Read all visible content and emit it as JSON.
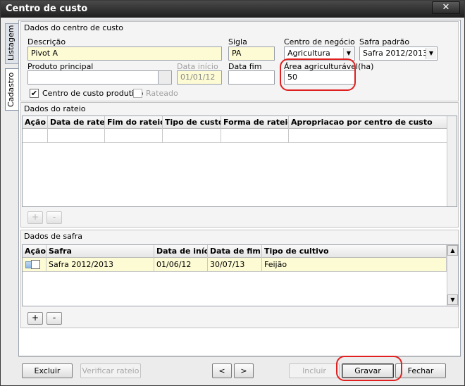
{
  "window": {
    "title": "Centro de custo",
    "close_symbol": "✕"
  },
  "tabs": [
    {
      "label": "Listagem",
      "active": false
    },
    {
      "label": "Cadastro",
      "active": true
    }
  ],
  "dados_centro": {
    "section_title": "Dados do centro de custo",
    "descricao_label": "Descrição",
    "descricao_value": "Pivot A",
    "sigla_label": "Sigla",
    "sigla_value": "PA",
    "centro_negocio_label": "Centro de negócio",
    "centro_negocio_value": "Agricultura",
    "safra_padrao_label": "Safra padrão",
    "safra_padrao_value": "Safra 2012/2013",
    "produto_label": "Produto principal",
    "produto_value": "",
    "data_inicio_label": "Data início",
    "data_inicio_value": "01/01/12",
    "data_fim_label": "Data fim",
    "data_fim_value": "",
    "area_label": "Área agriculturável(ha)",
    "area_value": "50",
    "ccp_label": "Centro de custo produtivo",
    "ccp_checked": true,
    "rateado_label": "Rateado",
    "rateado_checked": false
  },
  "dados_rateio": {
    "section_title": "Dados do rateio",
    "columns": [
      "Ação",
      "Data de rateio",
      "Fim do rateio",
      "Tipo de custo",
      "Forma de rateio",
      "Apropriacao por centro de custo"
    ],
    "add_label": "+",
    "remove_label": "-"
  },
  "dados_safra": {
    "section_title": "Dados de safra",
    "columns": [
      "Ação",
      "Safra",
      "Data de início",
      "Data de fim",
      "Tipo de cultivo"
    ],
    "rows": [
      {
        "safra": "Safra 2012/2013",
        "inicio": "01/06/12",
        "fim": "30/07/13",
        "cultivo": "Feijão"
      }
    ],
    "add_label": "+",
    "remove_label": "-"
  },
  "footer": {
    "excluir": "Excluir",
    "verificar": "Verificar rateio",
    "prev": "<",
    "next": ">",
    "incluir": "Incluir",
    "gravar": "Gravar",
    "fechar": "Fechar"
  },
  "highlight_color": "#e02020"
}
